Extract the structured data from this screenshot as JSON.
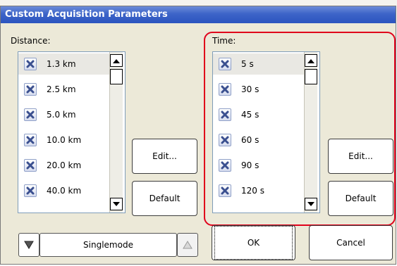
{
  "window": {
    "title": "Custom Acquisition Parameters"
  },
  "distance": {
    "label": "Distance:",
    "items": [
      {
        "label": "1.3 km"
      },
      {
        "label": "2.5 km"
      },
      {
        "label": "5.0 km"
      },
      {
        "label": "10.0 km"
      },
      {
        "label": "20.0 km"
      },
      {
        "label": "40.0 km"
      }
    ],
    "edit_label": "Edit...",
    "default_label": "Default"
  },
  "time": {
    "label": "Time:",
    "items": [
      {
        "label": "5 s"
      },
      {
        "label": "30 s"
      },
      {
        "label": "45 s"
      },
      {
        "label": "60 s"
      },
      {
        "label": "90 s"
      },
      {
        "label": "120 s"
      }
    ],
    "edit_label": "Edit...",
    "default_label": "Default"
  },
  "mode": {
    "value": "Singlemode"
  },
  "footer": {
    "ok_label": "OK",
    "cancel_label": "Cancel"
  },
  "colors": {
    "highlight": "#e0001b",
    "titlebar": "#3d64c8",
    "dialog_bg": "#ece9d8"
  }
}
